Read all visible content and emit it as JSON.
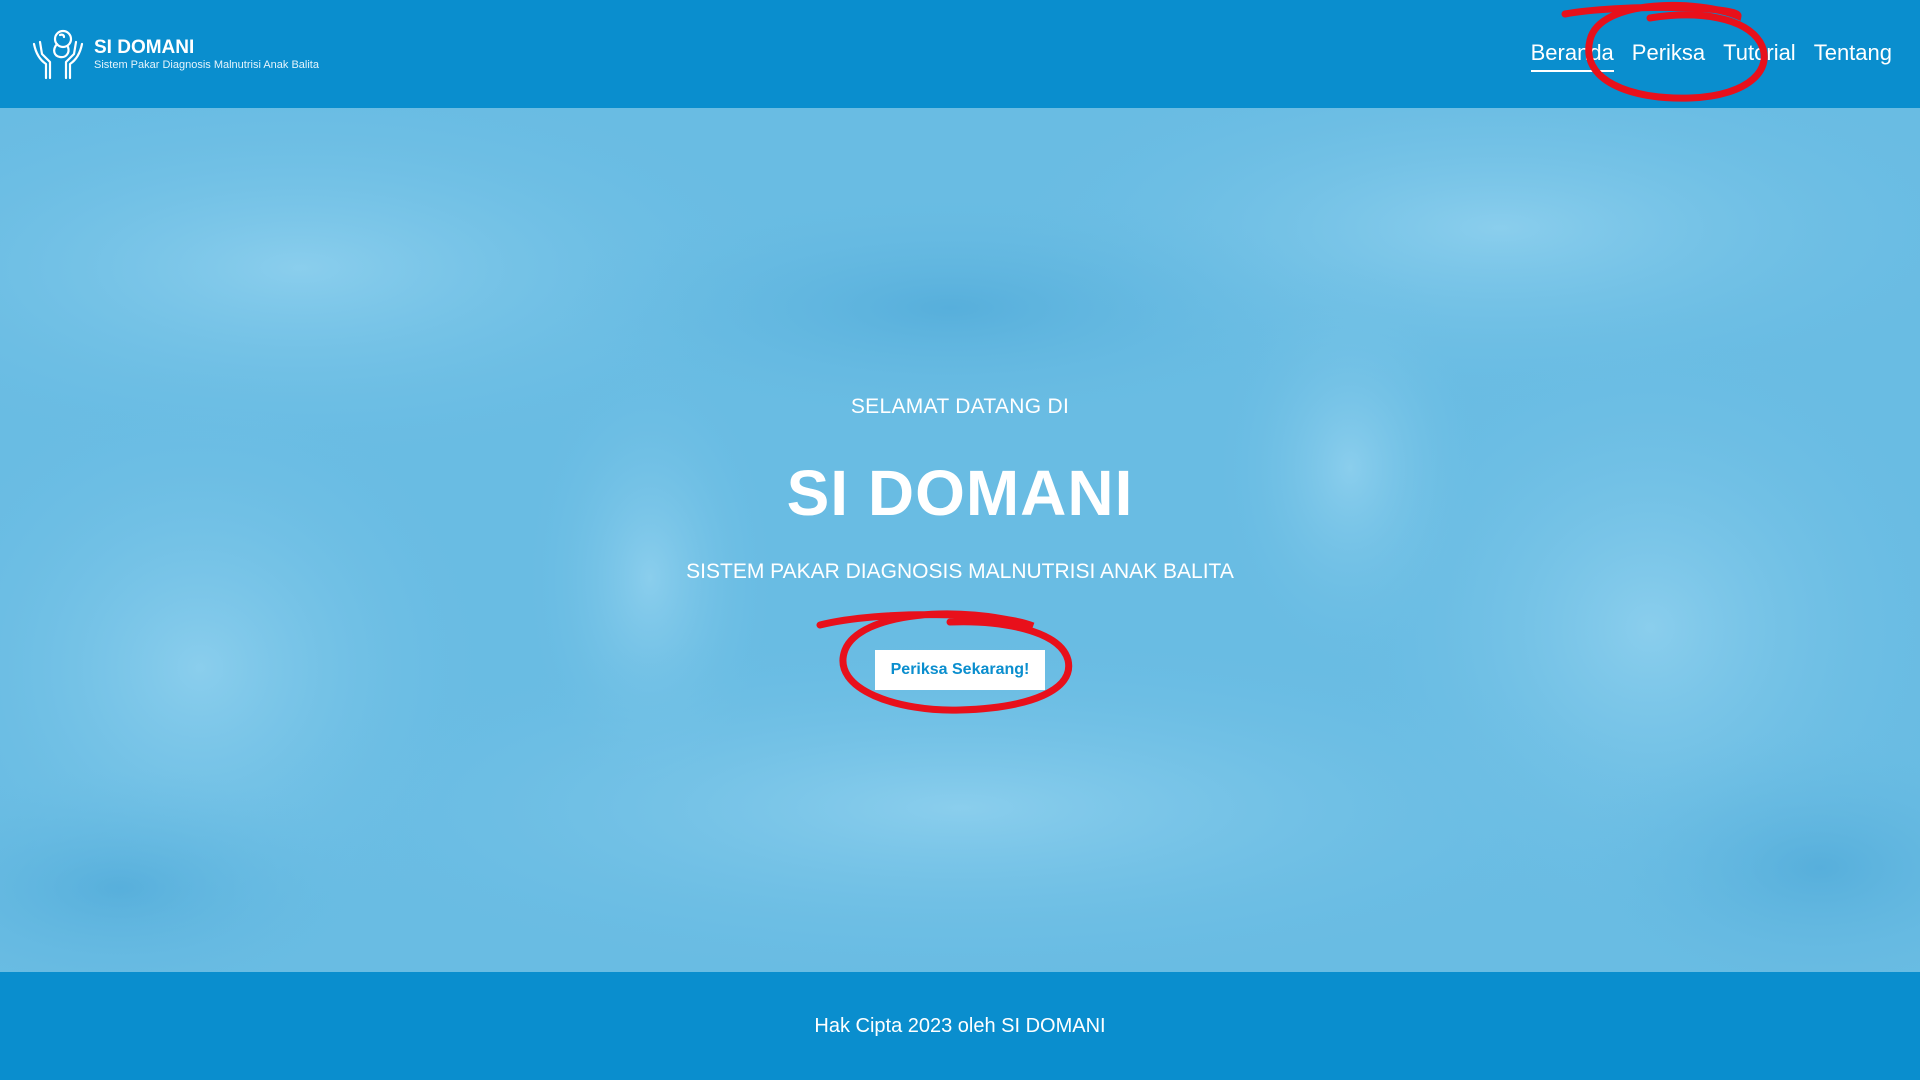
{
  "header": {
    "brand_title": "SI DOMANI",
    "brand_subtitle": "Sistem Pakar Diagnosis Malnutrisi Anak Balita",
    "logo_icon": "hands-holding-baby-icon",
    "nav": [
      {
        "label": "Beranda",
        "active": true
      },
      {
        "label": "Periksa",
        "active": false
      },
      {
        "label": "Tutorial",
        "active": false
      },
      {
        "label": "Tentang",
        "active": false
      }
    ]
  },
  "hero": {
    "welcome": "SELAMAT DATANG DI",
    "title": "SI DOMANI",
    "subtitle": "SISTEM PAKAR DIAGNOSIS MALNUTRISI ANAK BALITA",
    "cta_label": "Periksa Sekarang!"
  },
  "footer": {
    "copyright": "Hak Cipta 2023 oleh SI DOMANI"
  },
  "colors": {
    "primary": "#0A8ECE",
    "hero_overlay": "#69BCE3",
    "annotation": "#E8101B"
  }
}
